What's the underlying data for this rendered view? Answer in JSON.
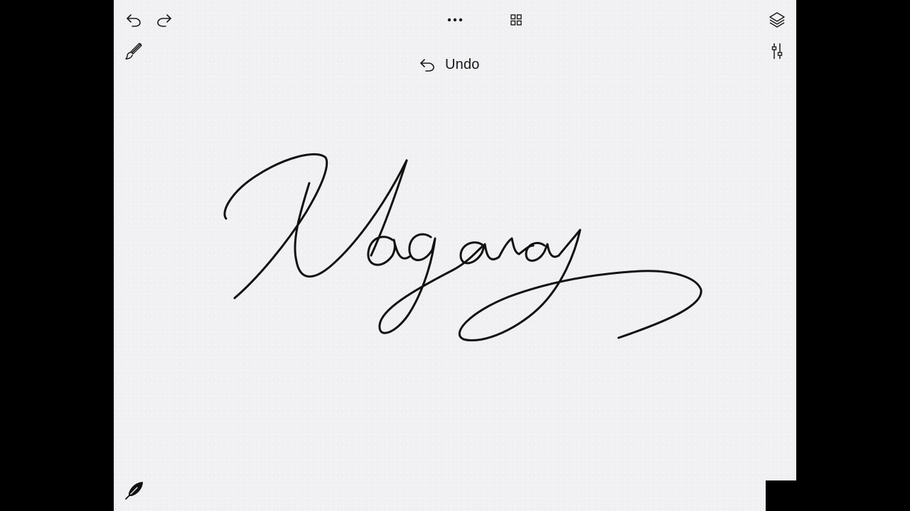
{
  "toolbar": {
    "undo_icon": "undo-arrow-icon",
    "redo_icon": "redo-arrow-icon",
    "more_icon": "ellipsis-icon",
    "gallery_icon": "grid-icon",
    "layers_icon": "layers-icon",
    "brush_icon": "paintbrush-icon",
    "adjust_icon": "sliders-icon",
    "quill_icon": "quill-feather-icon"
  },
  "toast": {
    "label": "Undo",
    "icon": "undo-arrow-icon"
  },
  "canvas": {
    "signature_text": "Nagaraj",
    "ink_color": "#111111",
    "paper_color": "#f1f0f2"
  }
}
